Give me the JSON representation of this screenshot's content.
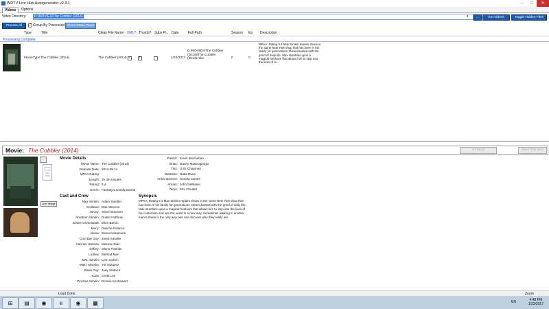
{
  "window": {
    "title": "WDTV Live Hub Autogenerator v2.3.1",
    "controls": [
      "–",
      "□",
      "✕"
    ]
  },
  "tabs": [
    {
      "label": "Videos"
    },
    {
      "label": "Options"
    }
  ],
  "video_dir": {
    "label": "Video Directory:",
    "value": "D:\\MOVIES\\The Cobbler (2014)",
    "dropdown": "▾",
    "browse": "...",
    "get_videos": "Get Videos",
    "toggle_hidden": "Toggle Hidden Files"
  },
  "toolbar": {
    "process_all": "Process All",
    "group_by": "Group By Processed",
    "group_checked": "✓",
    "show_detail": "Show Detail Panel"
  },
  "grid": {
    "headers": [
      "Type",
      "Title",
      "Clean File Name",
      "XML?",
      "Thumb?",
      "Subs Pr...",
      "Date",
      "Full Path",
      "Season",
      "Ep",
      "Description"
    ],
    "status": "Processing Complete",
    "row": {
      "type": "MovieType",
      "title": "The Cobbler (2014)",
      "clean": "The Cobbler (2014)",
      "xml": "✓",
      "thumb": "✓",
      "subs": "",
      "date": "1/22/2017",
      "path": "D:\\MOVIES\\The Cobbler (2014)\\The Cobbler (2014).mkv",
      "season": "0",
      "ep": "0",
      "description": "MPAA: Rating 5.4 Max Simkin repairs shoes in the same New York shop that has been in his family for generations. Disenchanted with the grind of daily life, Max stumbles upon a magical heirloom that allows him to step into the lives of hi..."
    }
  },
  "detail": {
    "label": "Movie:",
    "movie": "The Cobbler (2014)",
    "found_btn": "♦ Found",
    "save_btn": "Save This Item",
    "live_image": "Live Image",
    "placeholder": "Series Poster Not Used",
    "movie_details_title": "Movie Details",
    "details": [
      {
        "k": "Movie Name:",
        "v": "The Cobbler (2014)"
      },
      {
        "k": "Release Date:",
        "v": "2014-09-11"
      },
      {
        "k": "MPAA Rating:",
        "v": ""
      },
      {
        "k": "Length:",
        "v": "1h 39 minutes"
      },
      {
        "k": "Rating:",
        "v": "5.4"
      },
      {
        "k": "Genre:",
        "v": "Fantasy,Comedy,Drama"
      }
    ],
    "cast_title": "Cast and Crew",
    "cast_left": [
      {
        "k": "Max Simkin:",
        "v": "Adam Sandler"
      },
      {
        "k": "Emiliano:",
        "v": "Dan Stevens"
      },
      {
        "k": "Jimmy:",
        "v": "Steve Buscemi"
      },
      {
        "k": "Abraham Simkin:",
        "v": "Dustin Hoffman"
      },
      {
        "k": "Elaine Greenawalt:",
        "v": "Ellen Barkin"
      },
      {
        "k": "Macy:",
        "v": "Dascha Polanco"
      },
      {
        "k": "Alexia:",
        "v": "Elena Kampouris"
      },
      {
        "k": "Cool Bar Guy:",
        "v": "Jared Sandler"
      },
      {
        "k": "Carmen Herrera:",
        "v": "Melonie Diaz"
      },
      {
        "k": "Jeffrey:",
        "v": "Glenn Fleshler"
      },
      {
        "k": "Ludlow:",
        "v": "Method Man"
      },
      {
        "k": "Mrs. Simkin:",
        "v": "Lynn Cohen"
      },
      {
        "k": "Max / Marsha:",
        "v": "Yul Vazquez"
      },
      {
        "k": "Sleek Guy:",
        "v": "Joey Slotnick"
      },
      {
        "k": "Kara:",
        "v": "Greta Lee"
      },
      {
        "k": "Pinchas Simkin:",
        "v": "Donnie Keshawarz"
      }
    ],
    "cast_right": [
      {
        "k": "Patrick:",
        "v": "Kevin Breznahan"
      },
      {
        "k": "Brian:",
        "v": "Danny Mastrogiorgio"
      },
      {
        "k": "Tino:",
        "v": "Gritz Chapman"
      },
      {
        "k": "Waitress:",
        "v": "Natia Dune"
      },
      {
        "k": "Anna Stevens:",
        "v": "Sondra James"
      },
      {
        "k": "Ahram:",
        "v": "John DeBlasio"
      },
      {
        "k": "Taryn:",
        "v": "Kim Clouber"
      }
    ],
    "synopsis_title": "Synopsis",
    "synopsis": "MPAA: Rating 5.4 Max Simkin repairs shoes in the same New York shop that has been in his family for generations. Disenchanted with the grind of daily life, Max stumbles upon a magical heirloom that allows him to step into the lives of his customers and see the world in a new way. Sometimes walking in another man's shoes is the only way one can discover who they really are."
  },
  "statusbar": {
    "text": "Load Done.",
    "zoom": "Zoom"
  },
  "taskbar": {
    "lang": "EN",
    "time": "4:48 PM",
    "date": "1/23/2017"
  }
}
